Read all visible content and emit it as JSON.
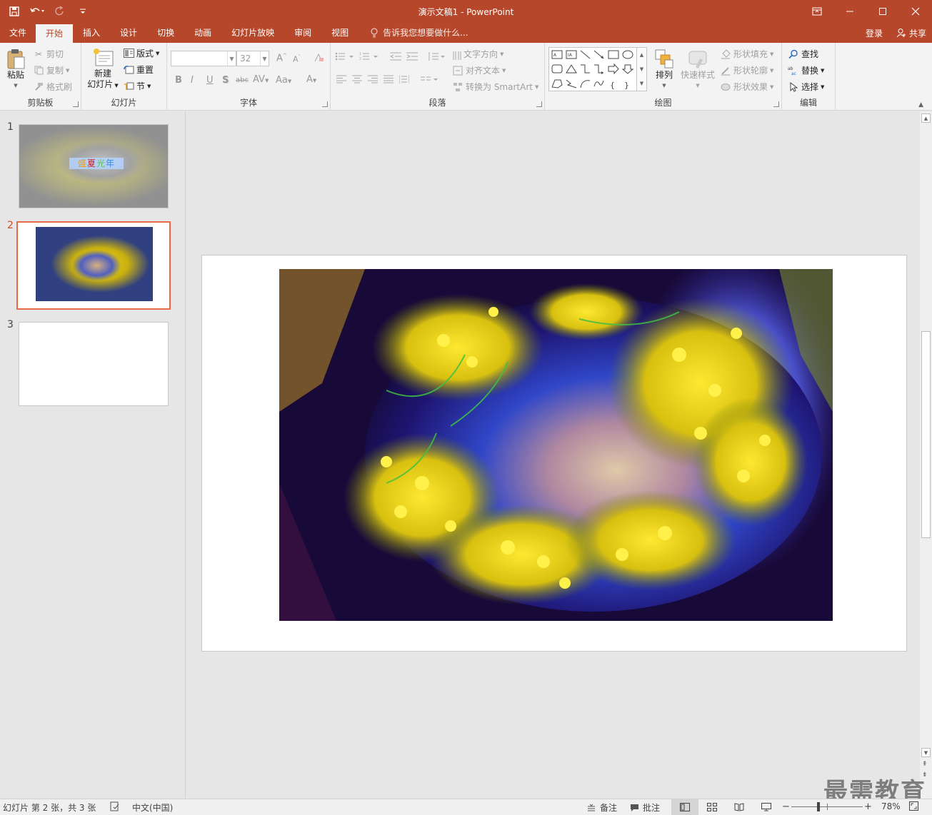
{
  "titlebar": {
    "title": "演示文稿1 - PowerPoint",
    "icons": [
      "save-icon",
      "undo-icon",
      "redo-icon",
      "customize-qat-icon"
    ],
    "window_controls": [
      "ribbon-display-icon",
      "minimize-icon",
      "maximize-icon",
      "close-icon"
    ]
  },
  "tabs": {
    "items": [
      "文件",
      "开始",
      "插入",
      "设计",
      "切换",
      "动画",
      "幻灯片放映",
      "审阅",
      "视图"
    ],
    "active": "开始",
    "tell_me": "告诉我您想要做什么...",
    "login": "登录",
    "share": "共享"
  },
  "ribbon": {
    "clipboard": {
      "label": "剪贴板",
      "paste": "粘贴",
      "cut": "剪切",
      "copy": "复制",
      "format_painter": "格式刷"
    },
    "slides": {
      "label": "幻灯片",
      "new_slide_line1": "新建",
      "new_slide_line2": "幻灯片",
      "layout": "版式",
      "reset": "重置",
      "section": "节"
    },
    "font": {
      "label": "字体",
      "font_name": "",
      "font_size": "32"
    },
    "paragraph": {
      "label": "段落",
      "text_direction": "文字方向",
      "align_text": "对齐文本",
      "convert_smartart": "转换为 SmartArt"
    },
    "drawing": {
      "label": "绘图",
      "arrange": "排列",
      "quick_styles": "快速样式",
      "shape_fill": "形状填充",
      "shape_outline": "形状轮廓",
      "shape_effects": "形状效果"
    },
    "editing": {
      "label": "编辑",
      "find": "查找",
      "replace": "替换",
      "select": "选择"
    }
  },
  "thumbnails": {
    "selected": 2,
    "items": [
      {
        "number": "1",
        "title_chars": [
          "盛",
          "夏",
          "光",
          "年"
        ]
      },
      {
        "number": "2"
      },
      {
        "number": "3"
      }
    ]
  },
  "statusbar": {
    "slide_info": "幻灯片 第 2 张，共 3 张",
    "language": "中文(中国)",
    "notes": "备注",
    "comments": "批注",
    "zoom": "78%",
    "zoom_percent": 78
  },
  "watermark": "最需教育",
  "colors": {
    "accent": "#b7472a",
    "selection": "#e8694a"
  }
}
